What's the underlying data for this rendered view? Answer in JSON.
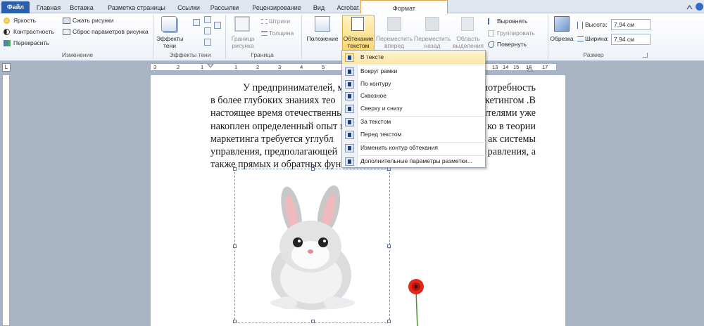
{
  "tabs": [
    {
      "label": "Файл"
    },
    {
      "label": "Главная"
    },
    {
      "label": "Вставка"
    },
    {
      "label": "Разметка страницы"
    },
    {
      "label": "Ссылки"
    },
    {
      "label": "Рассылки"
    },
    {
      "label": "Рецензирование"
    },
    {
      "label": "Вид"
    },
    {
      "label": "Acrobat"
    },
    {
      "label": "Формат"
    }
  ],
  "ribbon": {
    "change": {
      "brightness": "Яркость",
      "contrast": "Контрастность",
      "recolor": "Перекрасить",
      "compress": "Сжать рисунки",
      "reset": "Сброс параметров рисунка",
      "group": "Изменение"
    },
    "shadow": {
      "effects_line1": "Эффекты",
      "effects_line2": "тени",
      "group": "Эффекты тени"
    },
    "border": {
      "border_line1": "Граница",
      "border_line2": "рисунка",
      "dashes": "Штрихи",
      "weight": "Толщина",
      "group": "Граница"
    },
    "arrange": {
      "position": "Положение",
      "wrap_line1": "Обтекание",
      "wrap_line2": "текстом",
      "forward_line1": "Переместить",
      "forward_line2": "вперед",
      "backward_line1": "Переместить",
      "backward_line2": "назад",
      "pane_line1": "Область",
      "pane_line2": "выделения",
      "align": "Выровнять",
      "group_btn": "Группировать",
      "rotate": "Повернуть"
    },
    "size": {
      "crop": "Обрезка",
      "height_label": "Высота:",
      "height_value": "7,94 см",
      "width_label": "Ширина:",
      "width_value": "7,94 см",
      "group": "Размер"
    }
  },
  "ruler": {
    "corner": "L",
    "numbers": [
      "3",
      "2",
      "1",
      "1",
      "2",
      "3",
      "4",
      "5",
      "6",
      "7",
      "8",
      "9",
      "10",
      "11",
      "12",
      "13",
      "14",
      "15",
      "16",
      "17"
    ]
  },
  "document": {
    "lines": [
      "У предпринимателей, мар",
      "в более глубоких знаниях тео",
      "настоящее время отечественны",
      "накоплен определенный опыт м",
      "маркетинга требуется углубл",
      "управления, предполагающей",
      "также прямых и обратных фун"
    ],
    "lines_right": [
      "потребность",
      "кетингом .В",
      "ителями уже",
      "ко в теории",
      "ак системы",
      "равления, а",
      ""
    ]
  },
  "wrap_menu": {
    "items": [
      {
        "label": "В тексте"
      },
      {
        "label": "Вокруг рамки"
      },
      {
        "label": "По контуру"
      },
      {
        "label": "Сквозное"
      },
      {
        "label": "Сверху и снизу"
      },
      {
        "label": "За текстом"
      },
      {
        "label": "Перед текстом"
      },
      {
        "label": "Изменить контур обтекания"
      },
      {
        "label": "Дополнительные параметры разметки..."
      }
    ]
  },
  "colors": {
    "file_tab": "#2a5fb0",
    "format_tab_accent": "#f2b66a",
    "highlight": "#fbe7a8"
  }
}
